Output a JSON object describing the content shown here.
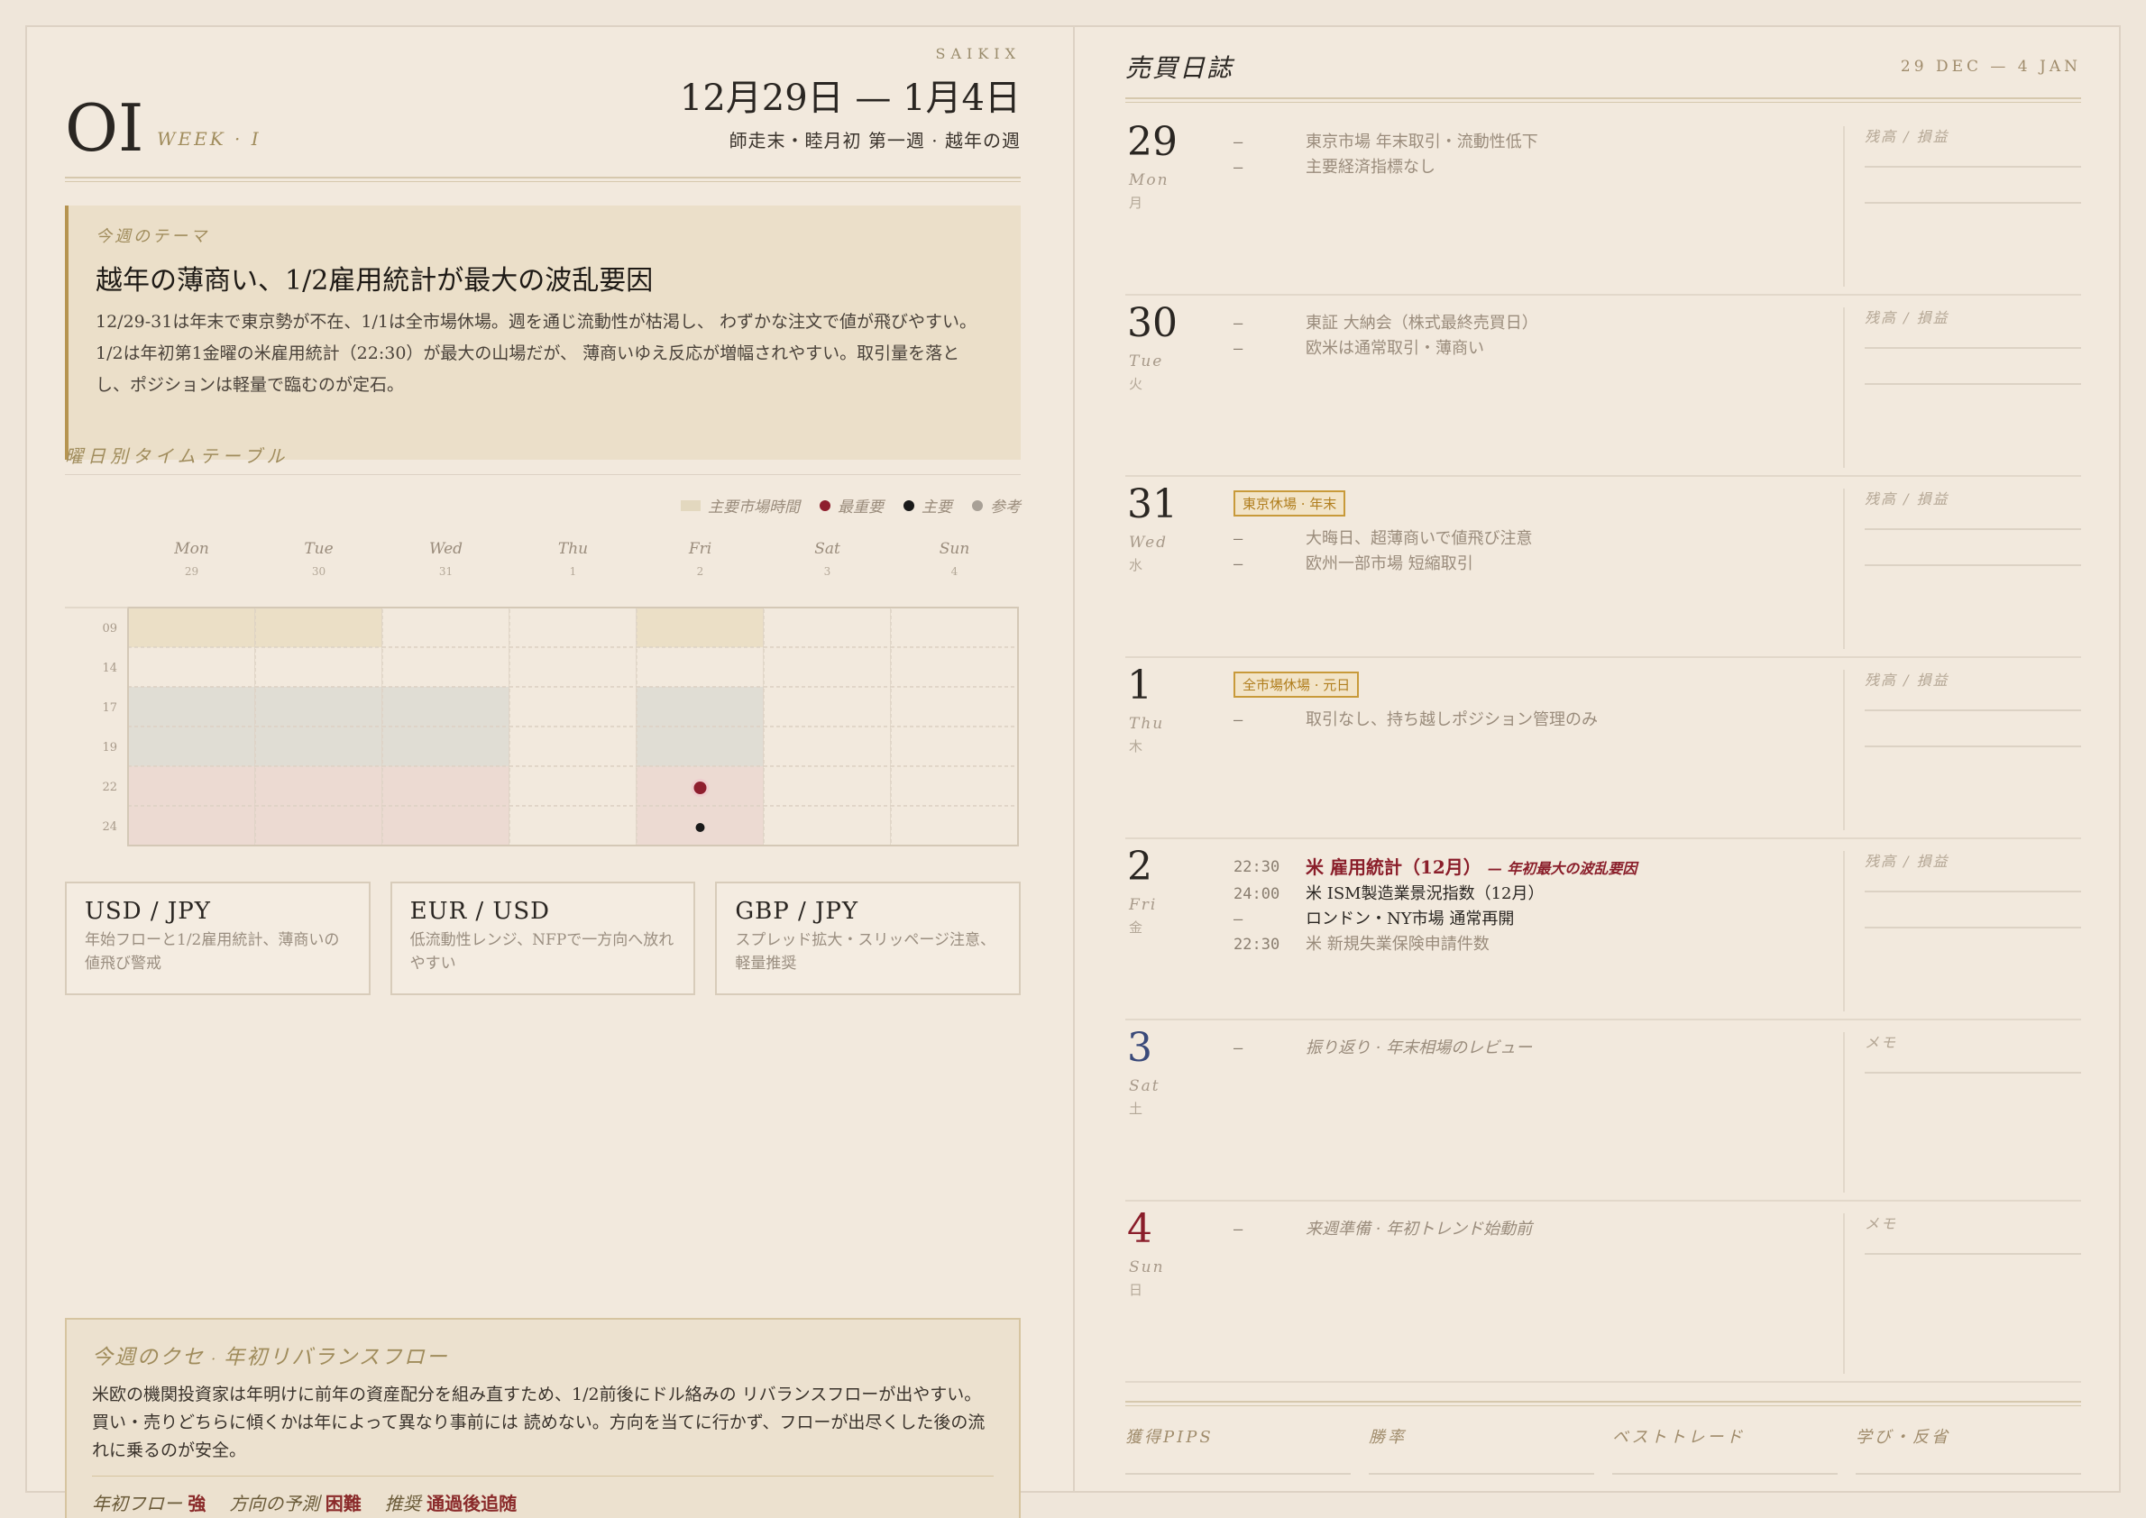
{
  "left": {
    "brand": "SAIKIX",
    "date_range": "12月29日 — 1月4日",
    "subtitle": "師走末・睦月初 第一週 · 越年の週",
    "week_num": "OI",
    "week_label": "WEEK · I",
    "theme": {
      "label": "今週のテーマ",
      "title": "越年の薄商い、1/2雇用統計が最大の波乱要因",
      "body": "12/29-31は年末で東京勢が不在、1/1は全市場休場。週を通じ流動性が枯渇し、 わずかな注文で値が飛びやすい。1/2は年初第1金曜の米雇用統計（22:30）が最大の山場だが、 薄商いゆえ反応が増幅されやすい。取引量を落とし、ポジションは軽量で臨むのが定石。"
    },
    "timetable": {
      "title": "曜日別タイムテーブル",
      "legend": {
        "main_hours": "主要市場時間",
        "most_important": "最重要",
        "important": "主要",
        "reference": "参考"
      }
    },
    "pairs": [
      {
        "name": "USD / JPY",
        "desc": "年始フローと1/2雇用統計、薄商いの値飛び警戒"
      },
      {
        "name": "EUR / USD",
        "desc": "低流動性レンジ、NFPで一方向へ放れやすい"
      },
      {
        "name": "GBP / JPY",
        "desc": "スプレッド拡大・スリッページ注意、軽量推奨"
      }
    ],
    "habit": {
      "title_a": "今週のクセ",
      "title_b": "年初リバランスフロー",
      "body": "米欧の機関投資家は年明けに前年の資産配分を組み直すため、1/2前後にドル絡みの リバランスフローが出やすい。買い・売りどちらに傾くかは年によって異なり事前には 読めない。方向を当てに行かず、フローが出尽くした後の流れに乗るのが安全。",
      "tags": [
        {
          "k": "年初フロー",
          "v": "強"
        },
        {
          "k": "方向の予測",
          "v": "困難"
        },
        {
          "k": "推奨",
          "v": "通過後追随"
        }
      ]
    }
  },
  "chart_data": {
    "type": "heatmap",
    "days": [
      {
        "en": "Mon",
        "d": "29"
      },
      {
        "en": "Tue",
        "d": "30"
      },
      {
        "en": "Wed",
        "d": "31"
      },
      {
        "en": "Thu",
        "d": "1"
      },
      {
        "en": "Fri",
        "d": "2"
      },
      {
        "en": "Sat",
        "d": "3"
      },
      {
        "en": "Sun",
        "d": "4"
      }
    ],
    "hours": [
      "09",
      "14",
      "17",
      "19",
      "22",
      "24"
    ],
    "cells": [
      [
        "tokyo",
        "tokyo",
        "",
        "",
        "tokyo",
        "",
        ""
      ],
      [
        "",
        "",
        "",
        "",
        "",
        "",
        ""
      ],
      [
        "london",
        "london",
        "london",
        "",
        "london",
        "",
        ""
      ],
      [
        "london",
        "london",
        "london",
        "",
        "london",
        "",
        ""
      ],
      [
        "ny",
        "ny",
        "ny",
        "",
        "ny",
        "",
        ""
      ],
      [
        "ny",
        "ny",
        "ny",
        "",
        "ny",
        "",
        ""
      ]
    ],
    "cell_colors": {
      "tokyo": "#ebdfc6",
      "london": "#e0ddd4",
      "ny": "#ecdad2",
      "": "#f2e9dd"
    },
    "markers": [
      {
        "day": "Fri",
        "hour": "22",
        "level": "most_important",
        "color": "#8e1e2e"
      },
      {
        "day": "Fri",
        "hour": "24",
        "level": "important",
        "color": "#1a1a1a"
      }
    ],
    "colors": {
      "most_important": "#8e1e2e",
      "important": "#1a1a1a",
      "reference": "#a8a096",
      "main_hours": "#e3d8bf"
    }
  },
  "right": {
    "title": "売買日誌",
    "range": "29 DEC — 4 JAN",
    "days": [
      {
        "num": "29",
        "en": "Mon",
        "jp": "月",
        "badge": "",
        "memo": "残高 / 損益",
        "lines": 2,
        "entries": [
          {
            "t": "—",
            "x": "東京市場 年末取引・流動性低下"
          },
          {
            "t": "—",
            "x": "主要経済指標なし"
          }
        ]
      },
      {
        "num": "30",
        "en": "Tue",
        "jp": "火",
        "badge": "",
        "memo": "残高 / 損益",
        "lines": 2,
        "entries": [
          {
            "t": "—",
            "x": "東証 大納会（株式最終売買日）"
          },
          {
            "t": "—",
            "x": "欧米は通常取引・薄商い"
          }
        ]
      },
      {
        "num": "31",
        "en": "Wed",
        "jp": "水",
        "badge": "東京休場 · 年末",
        "memo": "残高 / 損益",
        "lines": 2,
        "entries": [
          {
            "t": "—",
            "x": "大晦日、超薄商いで値飛び注意"
          },
          {
            "t": "—",
            "x": "欧州一部市場 短縮取引"
          }
        ]
      },
      {
        "num": "1",
        "en": "Thu",
        "jp": "木",
        "badge": "全市場休場 · 元日",
        "memo": "残高 / 損益",
        "lines": 2,
        "entries": [
          {
            "t": "—",
            "x": "取引なし、持ち越しポジション管理のみ"
          }
        ]
      },
      {
        "num": "2",
        "en": "Fri",
        "jp": "金",
        "badge": "",
        "memo": "残高 / 損益",
        "lines": 2,
        "entries": [
          {
            "t": "22:30",
            "x": "米 雇用統計（12月）",
            "sub": "— 年初最大の波乱要因",
            "style": "red"
          },
          {
            "t": "24:00",
            "x": "米 ISM製造業景況指数（12月）",
            "style": "dark"
          },
          {
            "t": "—",
            "x": "ロンドン・NY市場 通常再開",
            "style": "dark"
          },
          {
            "t": "22:30",
            "x": "米 新規失業保険申請件数"
          }
        ]
      },
      {
        "num": "3",
        "en": "Sat",
        "jp": "土",
        "badge": "",
        "memo": "メモ",
        "lines": 1,
        "color": "#3a4a7a",
        "entries": [
          {
            "t": "—",
            "x": "振り返り · 年末相場のレビュー",
            "style": "italic"
          }
        ]
      },
      {
        "num": "4",
        "en": "Sun",
        "jp": "日",
        "badge": "",
        "memo": "メモ",
        "lines": 1,
        "color": "#8a1e2a",
        "entries": [
          {
            "t": "—",
            "x": "来週準備 · 年初トレンド始動前",
            "style": "italic"
          }
        ]
      }
    ],
    "footer": [
      "獲得PIPS",
      "勝率",
      "ベストトレード",
      "学び・反省"
    ]
  }
}
